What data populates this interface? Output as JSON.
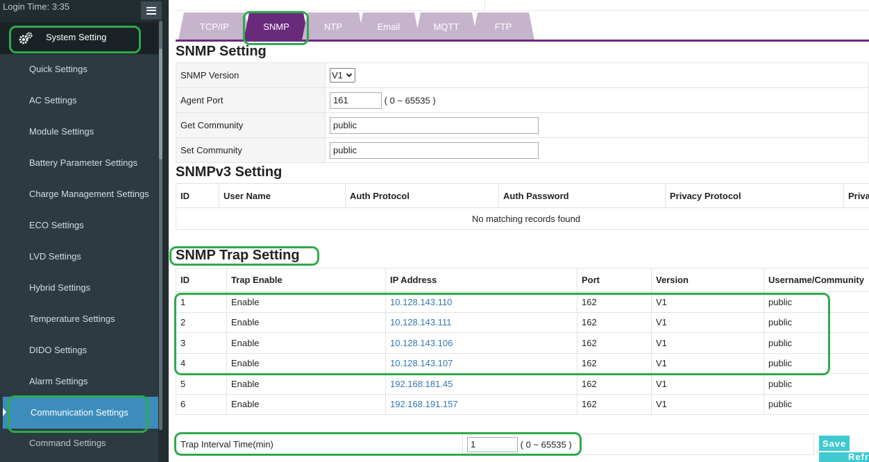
{
  "sidebar": {
    "login_time": "Login Time:  3:35",
    "system_setting": "System Setting",
    "items": [
      "Quick Settings",
      "AC Settings",
      "Module Settings",
      "Battery Parameter Settings",
      "Charge Management Settings",
      "ECO Settings",
      "LVD Settings",
      "Hybrid Settings",
      "Temperature Settings",
      "DIDO Settings",
      "Alarm Settings"
    ],
    "active_item": "Communication Settings",
    "cut_item": "Command Settings"
  },
  "tabs": [
    "TCP/IP",
    "SNMP",
    "NTP",
    "Email",
    "MQTT",
    "FTP"
  ],
  "active_tab": "SNMP",
  "snmp_setting": {
    "title": "SNMP Setting",
    "version_label": "SNMP Version",
    "version_value": "V1",
    "agent_port_label": "Agent Port",
    "agent_port_value": "161",
    "agent_port_range": "( 0 ~ 65535 )",
    "get_community_label": "Get Community",
    "get_community_value": "public",
    "set_community_label": "Set Community",
    "set_community_value": "public"
  },
  "snmpv3": {
    "title": "SNMPv3 Setting",
    "columns": [
      "ID",
      "User Name",
      "Auth Protocol",
      "Auth Password",
      "Privacy Protocol",
      "Priva"
    ],
    "empty_message": "No matching records found"
  },
  "trap": {
    "title": "SNMP Trap Setting",
    "columns": [
      "ID",
      "Trap Enable",
      "IP Address",
      "Port",
      "Version",
      "Username/Community"
    ],
    "rows": [
      {
        "id": "1",
        "enable": "Enable",
        "ip": "10.128.143.110",
        "port": "162",
        "version": "V1",
        "community": "public"
      },
      {
        "id": "2",
        "enable": "Enable",
        "ip": "10.128.143.111",
        "port": "162",
        "version": "V1",
        "community": "public"
      },
      {
        "id": "3",
        "enable": "Enable",
        "ip": "10.128.143.106",
        "port": "162",
        "version": "V1",
        "community": "public"
      },
      {
        "id": "4",
        "enable": "Enable",
        "ip": "10.128.143.107",
        "port": "162",
        "version": "V1",
        "community": "public"
      },
      {
        "id": "5",
        "enable": "Enable",
        "ip": "192.168.181.45",
        "port": "162",
        "version": "V1",
        "community": "public"
      },
      {
        "id": "6",
        "enable": "Enable",
        "ip": "192.168.191.157",
        "port": "162",
        "version": "V1",
        "community": "public"
      }
    ],
    "interval_label": "Trap Interval Time(min)",
    "interval_value": "1",
    "interval_range": "( 0 ~ 65535 )"
  },
  "buttons": {
    "save": "Save",
    "refresh": "Refresh"
  },
  "colors": {
    "sidebar_bg": "#222d32",
    "active_item": "#3c8dbc",
    "tab_active": "#6a2a7c",
    "tab_inactive": "#c6b4cc",
    "highlight_box": "#2eaa4b",
    "button": "#3fc9d1",
    "ip_link": "#3277b3"
  }
}
